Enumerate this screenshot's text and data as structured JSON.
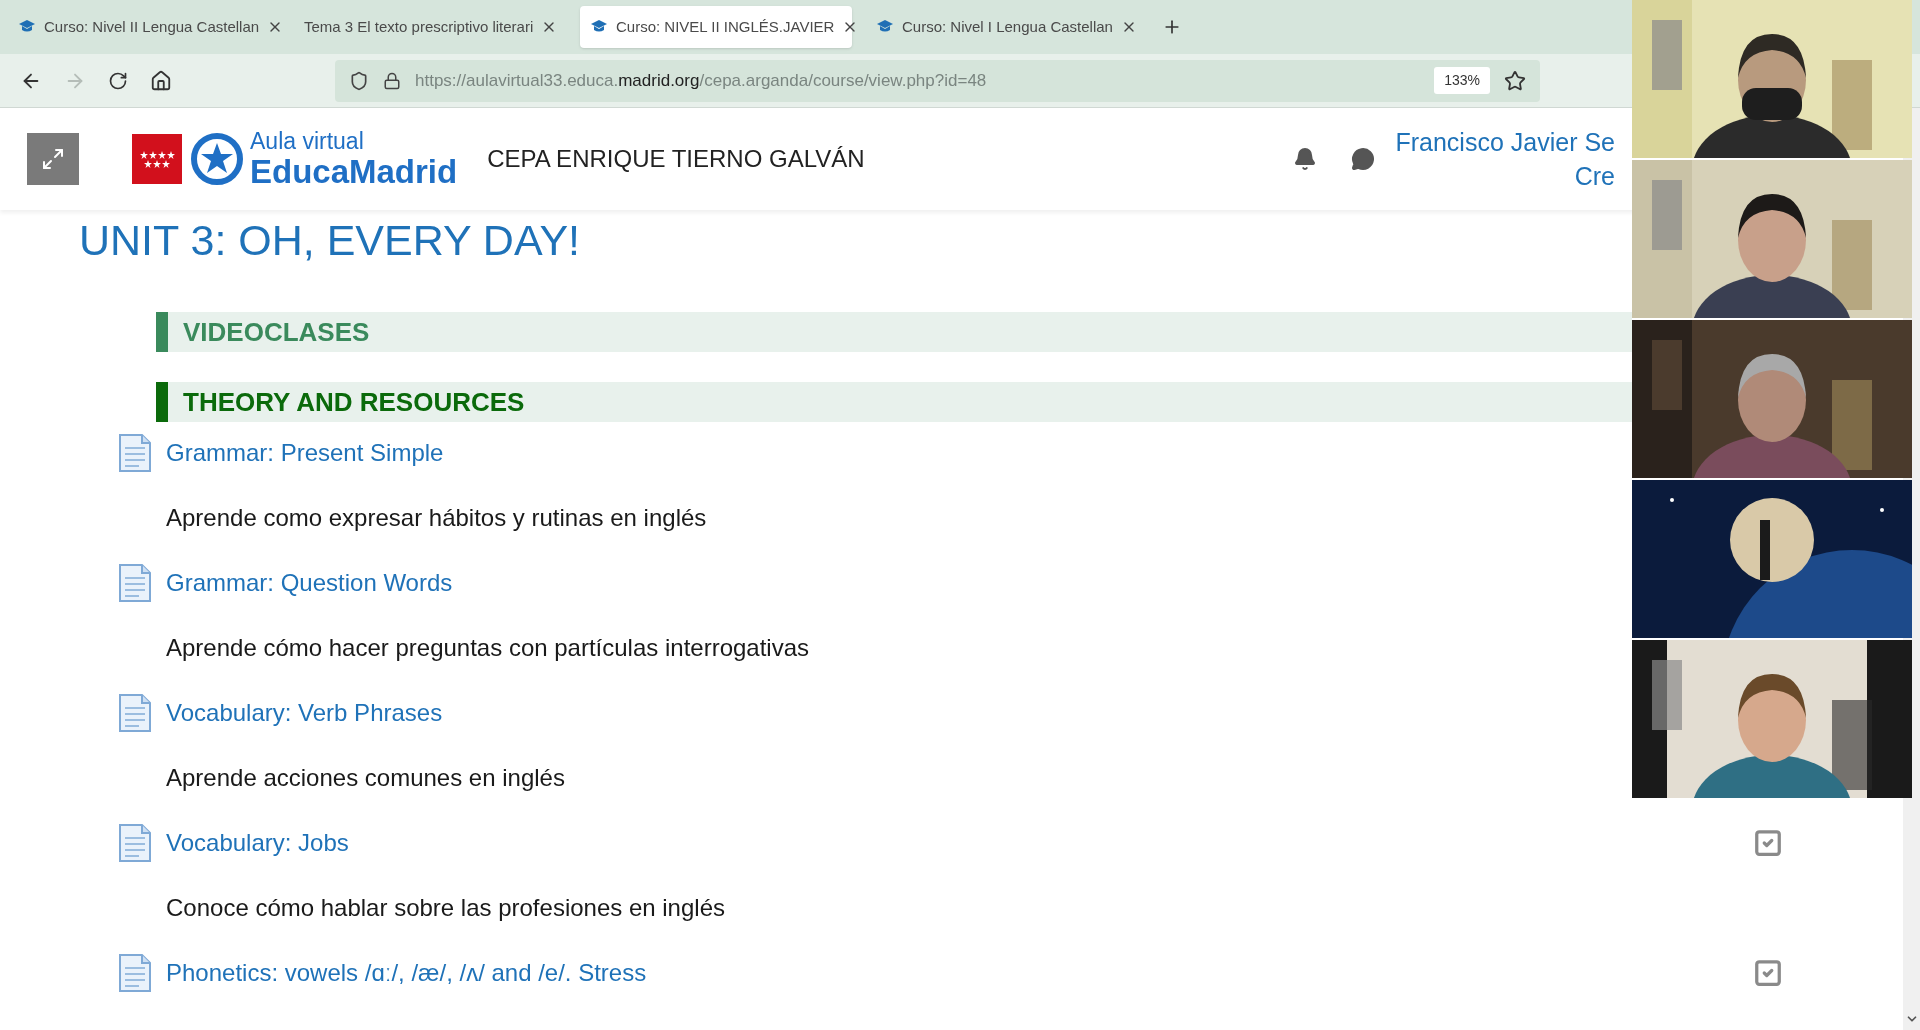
{
  "browser": {
    "tabs": [
      {
        "label": "Curso: Nivel II Lengua Castellan",
        "has_icon": true,
        "selected": false
      },
      {
        "label": "Tema 3 El texto prescriptivo literari",
        "has_icon": false,
        "selected": false
      },
      {
        "label": "Curso: NIVEL II INGLÉS.JAVIER",
        "has_icon": true,
        "selected": true
      },
      {
        "label": "Curso: Nivel I Lengua Castellan",
        "has_icon": true,
        "selected": false
      }
    ],
    "nav": [
      {
        "kind": "back",
        "disabled": false
      },
      {
        "kind": "forward",
        "disabled": true
      },
      {
        "kind": "reload",
        "disabled": false
      },
      {
        "kind": "home",
        "disabled": false
      }
    ],
    "url": {
      "prefix": "https://aulavirtual33.educa.",
      "domain": "madrid.org",
      "path": "/cepa.arganda/course/view.php?id=48"
    },
    "zoom": "133%"
  },
  "header": {
    "logo": {
      "line1": "Aula virtual",
      "line2": "EducaMadrid"
    },
    "school": "CEPA ENRIQUE TIERNO GALVÁN",
    "user_lines": [
      "Francisco Javier Se",
      "Cre"
    ]
  },
  "unit_title": "UNIT 3: OH, EVERY DAY!",
  "sections": [
    {
      "title": "VIDEOCLASES",
      "color": "#3a8a5c"
    },
    {
      "title": "THEORY AND RESOURCES",
      "color": "#0b6a0b"
    }
  ],
  "resources": [
    {
      "title": "Grammar: Present Simple",
      "description": "Aprende como expresar hábitos y rutinas en inglés"
    },
    {
      "title": "Grammar: Question Words",
      "description": "Aprende cómo hacer preguntas con partículas interrogativas"
    },
    {
      "title": "Vocabulary: Verb Phrases",
      "description": "Aprende acciones comunes en inglés"
    },
    {
      "title": "Vocabulary: Jobs",
      "description": "Conoce cómo hablar sobre las profesiones en inglés",
      "done": true
    },
    {
      "title": "Phonetics: vowels /ɑː/, /æ/, /ʌ/ and /e/. Stress",
      "done": true
    }
  ]
}
